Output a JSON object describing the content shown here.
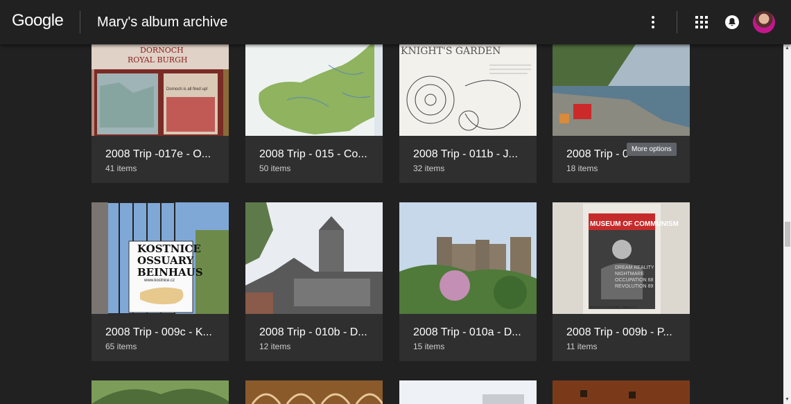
{
  "header": {
    "logo": "Google",
    "title": "Mary's album archive",
    "icons": {
      "more": "more-vert-icon",
      "apps": "apps-grid-icon",
      "notifications": "notifications-bell-icon"
    }
  },
  "tooltip": "More options",
  "albums": [
    {
      "title": "2008 Trip -017e - O...",
      "count": "41 items"
    },
    {
      "title": "2008 Trip - 015 - Co...",
      "count": "50 items"
    },
    {
      "title": "2008 Trip - 011b - J...",
      "count": "32 items"
    },
    {
      "title": "2008 Trip - 0",
      "count": "18 items"
    },
    {
      "title": "2008 Trip - 009c - K...",
      "count": "65 items"
    },
    {
      "title": "2008 Trip - 010b - D...",
      "count": "12 items"
    },
    {
      "title": "2008 Trip - 010a - D...",
      "count": "15 items"
    },
    {
      "title": "2008 Trip - 009b - P...",
      "count": "11 items"
    }
  ],
  "thumb_text": {
    "dornoch": "DORNOCH",
    "royal_burgh": "ROYAL BURGH",
    "dornoch_sub": "Dornoch is all fired up!",
    "garden": "KNIGHT'S GARDEN",
    "kostnice": "KOSTNICE",
    "ossuary": "OSSUARY",
    "beinhaus": "BEINHAUS",
    "kostnice_url": "www.kostnice.cz",
    "museum": "MUSEUM OF COMMUNISM",
    "poster": "DREAM REALITY NIGHTMARE OCCUPATION 68 REVOLUTION 89",
    "museum_foot": "Museum of Communism, Legacy s.r.o."
  },
  "colors": {
    "background": "#212121",
    "card": "#2f2f2f",
    "count_text": "#cfcfcf"
  }
}
